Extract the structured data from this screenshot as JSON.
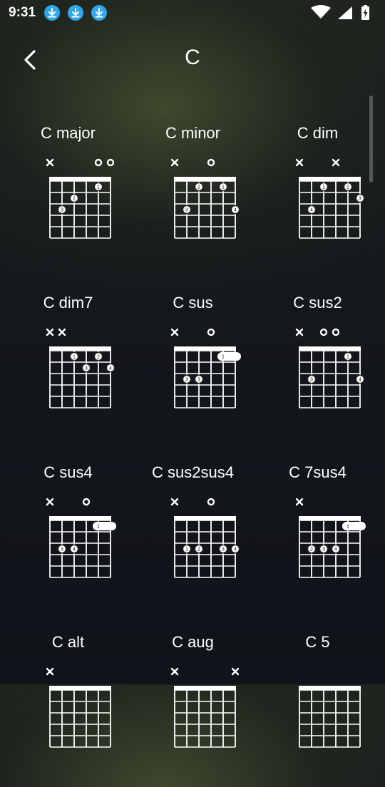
{
  "status_bar": {
    "time": "9:31",
    "notification_icons": [
      "download-icon",
      "download-icon",
      "download-icon"
    ],
    "system_icons": [
      "wifi-icon",
      "cellular-signal-icon",
      "battery-charging-icon"
    ]
  },
  "header": {
    "title": "C",
    "back_icon": "chevron-left-icon"
  },
  "chords": [
    {
      "name": "C major",
      "markers": [
        "x",
        "",
        "",
        "",
        "o",
        "o"
      ],
      "dots": [
        {
          "string": 5,
          "fret": 1,
          "finger": "1"
        },
        {
          "string": 3,
          "fret": 2,
          "finger": "2"
        },
        {
          "string": 2,
          "fret": 3,
          "finger": "3"
        }
      ]
    },
    {
      "name": "C minor",
      "markers": [
        "x",
        "",
        "",
        "o",
        "",
        ""
      ],
      "dots": [
        {
          "string": 3,
          "fret": 1,
          "finger": "2"
        },
        {
          "string": 5,
          "fret": 1,
          "finger": "1"
        },
        {
          "string": 2,
          "fret": 3,
          "finger": "3"
        },
        {
          "string": 6,
          "fret": 3,
          "finger": "4"
        }
      ]
    },
    {
      "name": "C dim",
      "markers": [
        "x",
        "",
        "",
        "x",
        "",
        ""
      ],
      "dots": [
        {
          "string": 3,
          "fret": 1,
          "finger": "1"
        },
        {
          "string": 5,
          "fret": 1,
          "finger": "2"
        },
        {
          "string": 6,
          "fret": 2,
          "finger": "3"
        },
        {
          "string": 2,
          "fret": 3,
          "finger": "4"
        }
      ]
    },
    {
      "name": "C dim7",
      "markers": [
        "x",
        "x",
        "",
        "",
        "",
        ""
      ],
      "dots": [
        {
          "string": 3,
          "fret": 1,
          "finger": "1"
        },
        {
          "string": 5,
          "fret": 1,
          "finger": "2"
        },
        {
          "string": 4,
          "fret": 2,
          "finger": "3"
        },
        {
          "string": 6,
          "fret": 2,
          "finger": "4"
        }
      ]
    },
    {
      "name": "C sus",
      "markers": [
        "x",
        "",
        "",
        "o",
        "",
        ""
      ],
      "dots": [
        {
          "string": 5,
          "fret": 1,
          "finger": "1",
          "barre_to": 6
        },
        {
          "string": 2,
          "fret": 3,
          "finger": "3"
        },
        {
          "string": 3,
          "fret": 3,
          "finger": "3"
        }
      ]
    },
    {
      "name": "C sus2",
      "markers": [
        "x",
        "",
        "o",
        "o",
        "",
        ""
      ],
      "dots": [
        {
          "string": 5,
          "fret": 1,
          "finger": "1"
        },
        {
          "string": 2,
          "fret": 3,
          "finger": "3"
        },
        {
          "string": 6,
          "fret": 3,
          "finger": "4"
        }
      ]
    },
    {
      "name": "C sus4",
      "markers": [
        "x",
        "",
        "",
        "o",
        "",
        ""
      ],
      "dots": [
        {
          "string": 5,
          "fret": 1,
          "finger": "1",
          "barre_to": 6
        },
        {
          "string": 2,
          "fret": 3,
          "finger": "3"
        },
        {
          "string": 3,
          "fret": 3,
          "finger": "4"
        }
      ]
    },
    {
      "name": "C sus2sus4",
      "markers": [
        "x",
        "",
        "",
        "o",
        "",
        ""
      ],
      "dots": [
        {
          "string": 2,
          "fret": 3,
          "finger": "1"
        },
        {
          "string": 3,
          "fret": 3,
          "finger": "2"
        },
        {
          "string": 5,
          "fret": 3,
          "finger": "3"
        },
        {
          "string": 6,
          "fret": 3,
          "finger": "4"
        }
      ]
    },
    {
      "name": "C 7sus4",
      "markers": [
        "x",
        "",
        "",
        "",
        "",
        ""
      ],
      "dots": [
        {
          "string": 5,
          "fret": 1,
          "finger": "1",
          "barre_to": 6
        },
        {
          "string": 2,
          "fret": 3,
          "finger": "2"
        },
        {
          "string": 3,
          "fret": 3,
          "finger": "3"
        },
        {
          "string": 4,
          "fret": 3,
          "finger": "4"
        }
      ]
    },
    {
      "name": "C alt",
      "markers": [
        "x",
        "",
        "",
        "",
        "",
        ""
      ],
      "dots": []
    },
    {
      "name": "C aug",
      "markers": [
        "x",
        "",
        "",
        "",
        "",
        "x"
      ],
      "dots": []
    },
    {
      "name": "C 5",
      "markers": [
        "",
        "",
        "",
        "",
        "",
        ""
      ],
      "dots": []
    }
  ]
}
